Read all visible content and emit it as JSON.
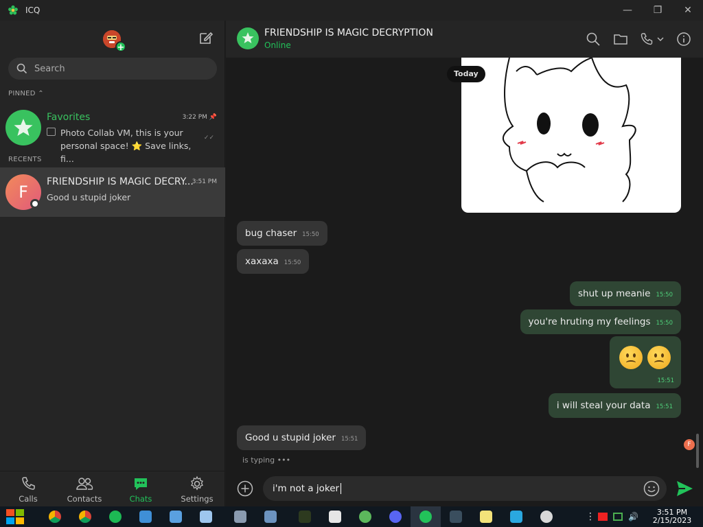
{
  "window": {
    "title": "ICQ",
    "min_label": "—",
    "max_label": "❐",
    "close_label": "✕"
  },
  "sidebar": {
    "search_placeholder": "Search",
    "pinned_label": "PINNED",
    "recents_label": "RECENTS",
    "pinned": [
      {
        "name": "Favorites",
        "time": "3:22 PM",
        "preview": "Photo Collab VM, this is your personal space! ⭐ Save links, fi...",
        "avatar_color": "#39c25f",
        "name_color": "#39c25f"
      }
    ],
    "recents": [
      {
        "name": "FRIENDSHIP IS MAGIC DECRY...",
        "time": "3:51 PM",
        "preview": "Good u stupid joker",
        "avatar_letter": "F",
        "avatar_color": "#ec6f4e"
      }
    ]
  },
  "nav": [
    {
      "label": "Calls",
      "icon": "phone-icon"
    },
    {
      "label": "Contacts",
      "icon": "contacts-icon"
    },
    {
      "label": "Chats",
      "icon": "chat-icon",
      "active": true
    },
    {
      "label": "Settings",
      "icon": "gear-icon"
    }
  ],
  "chat": {
    "title": "FRIENDSHIP IS MAGIC DECRYPTION",
    "status": "Online",
    "date_divider": "Today",
    "messages": [
      {
        "dir": "in",
        "text": "bug chaser",
        "time": "15:50"
      },
      {
        "dir": "in",
        "text": "xaxaxa",
        "time": "15:50"
      },
      {
        "dir": "out",
        "text": "shut up meanie",
        "time": "15:50"
      },
      {
        "dir": "out",
        "text": "you're hruting my feelings",
        "time": "15:50"
      },
      {
        "dir": "out",
        "text": "",
        "time": "15:51",
        "emoji": "😟😟"
      },
      {
        "dir": "out",
        "text": "i will steal your data",
        "time": "15:51"
      },
      {
        "dir": "in",
        "text": "Good u stupid joker",
        "time": "15:51"
      }
    ],
    "typing": "is typing  •••",
    "mini_avatar_letter": "F"
  },
  "composer": {
    "value": "i'm not a joker"
  },
  "taskbar": {
    "time": "3:51 PM",
    "date": "2/15/2023"
  },
  "colors": {
    "accent": "#22c25a",
    "outgoing": "#2f4634",
    "incoming": "#353535"
  }
}
